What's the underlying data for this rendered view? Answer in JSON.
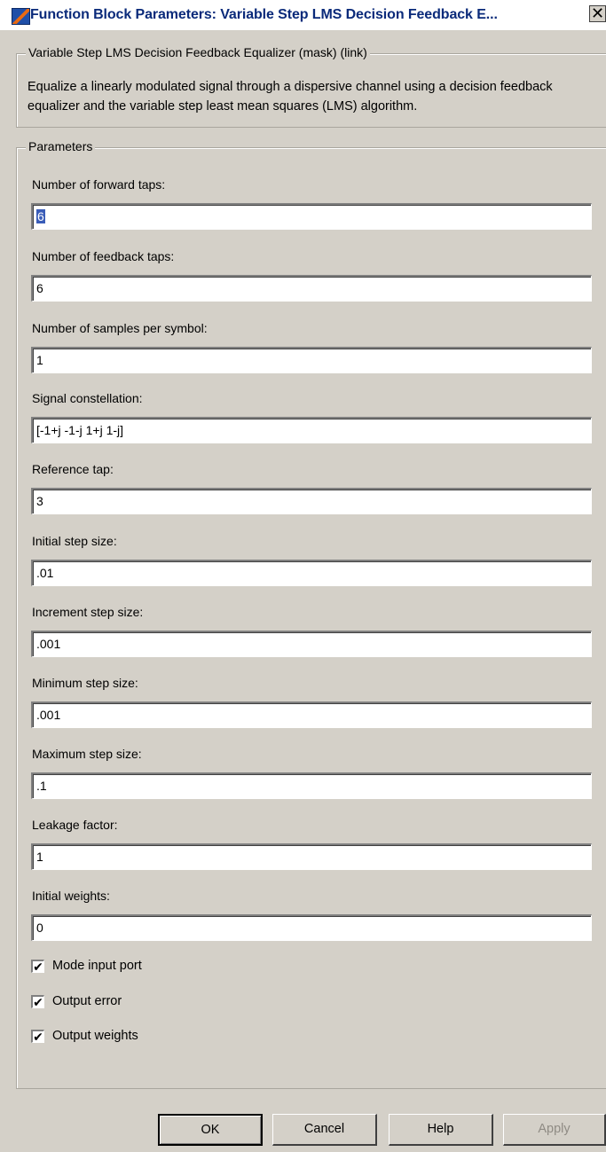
{
  "window": {
    "title": "Function Block Parameters: Variable Step LMS Decision Feedback E...",
    "close_glyph": "✕"
  },
  "mask": {
    "legend": "Variable Step LMS Decision Feedback Equalizer (mask) (link)",
    "description": "Equalize a linearly modulated signal through a dispersive channel using a decision feedback equalizer and the variable step least mean squares (LMS) algorithm."
  },
  "parameters": {
    "legend": "Parameters",
    "fields": [
      {
        "label": "Number of forward taps:",
        "value": "6"
      },
      {
        "label": "Number of feedback taps:",
        "value": "6"
      },
      {
        "label": "Number of samples per symbol:",
        "value": "1"
      },
      {
        "label": "Signal constellation:",
        "value": "[-1+j -1-j 1+j 1-j]"
      },
      {
        "label": "Reference tap:",
        "value": "3"
      },
      {
        "label": "Initial step size:",
        "value": ".01"
      },
      {
        "label": "Increment step size:",
        "value": ".001"
      },
      {
        "label": "Minimum step size:",
        "value": ".001"
      },
      {
        "label": "Maximum step size:",
        "value": ".1"
      },
      {
        "label": "Leakage factor:",
        "value": "1"
      },
      {
        "label": "Initial weights:",
        "value": "0"
      }
    ],
    "checkboxes": [
      {
        "label": "Mode input port",
        "checked": true,
        "mark": "✔"
      },
      {
        "label": "Output error",
        "checked": true,
        "mark": "✔"
      },
      {
        "label": "Output weights",
        "checked": true,
        "mark": "✔"
      }
    ]
  },
  "buttons": {
    "ok": "OK",
    "cancel": "Cancel",
    "help": "Help",
    "apply": "Apply"
  }
}
